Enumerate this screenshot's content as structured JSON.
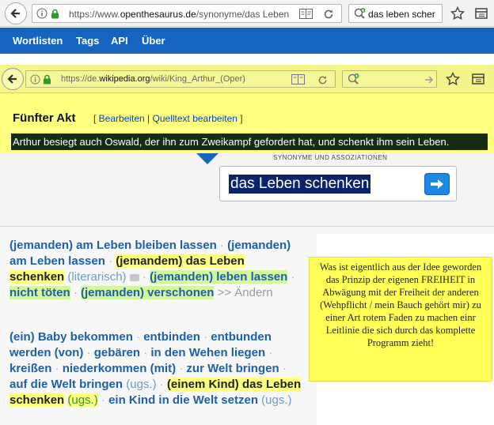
{
  "outer_browser": {
    "url_prefix": "https://www.",
    "url_domain": "openthesaurus.de",
    "url_suffix": "/synonyme/das Leben",
    "search_value": "das leben scher"
  },
  "site_nav": {
    "items": [
      {
        "label": "Wortlisten"
      },
      {
        "label": "Tags"
      },
      {
        "label": "API"
      },
      {
        "label": "Über"
      }
    ]
  },
  "inner_browser": {
    "url_prefix": "https://de.",
    "url_domain": "wikipedia.org",
    "url_suffix": "/wiki/King_Arthur_(Oper)",
    "search_value": ""
  },
  "wiki": {
    "section_title": "Fünfter Akt",
    "edit_open": "[ ",
    "edit_link": "Bearbeiten",
    "edit_sep": " | ",
    "source_link": "Quelltext bearbeiten",
    "edit_close": " ]",
    "summary": "Arthur besiegt auch Oswald, der ihn zum Zweikampf gefordert hat, und schenkt ihm sein Leben."
  },
  "search": {
    "small_caps": "SYNONYME UND ASSOZIATIONEN",
    "query": "das Leben schenken"
  },
  "results": {
    "group1": {
      "s1": "(jemanden) am Leben bleiben lassen",
      "s2": "(jemanden) am Leben lassen",
      "s3": "(jemandem) das Leben schenken",
      "s3_note": "(literarisch)",
      "s4": "(jemanden) leben lassen",
      "s5": "nicht töten",
      "s6": "(jemanden) verschonen",
      "change": ">> Ändern"
    },
    "group2": {
      "s1": "(ein) Baby bekommen",
      "s2": "entbinden",
      "s3": "entbunden werden (von)",
      "s4": "gebären",
      "s5": "in den Wehen liegen",
      "s6": "kreißen",
      "s7": "niederkommen (mit)",
      "s8": "zur Welt bringen",
      "s9": "auf die Welt bringen",
      "s9_note": "(ugs.)",
      "s10": "(einem Kind) das Leben schenken",
      "s10_note": "(ugs.)",
      "s11": "ein Kind in die Welt setzen",
      "s11_note": "(ugs.)"
    }
  },
  "sticky_note": {
    "text": "Was ist eigentlich aus der Idee geworden das Prinzip der eigenen FREIHEIT in Abwägung mit der Freiheit der anderen (Wehpflicht / mein Bauch gehört mir) zu einer Art rotem Faden zu machen einr Leitlinie die sich durch das komplette Programm zieht!"
  },
  "colors": {
    "nav_blue": "#1565c0",
    "overlay_yellow": "#ffff80",
    "highlight_green": "#d4f79c",
    "synonym_blue": "#1e5fa8",
    "summary_bg": "#152c15"
  }
}
